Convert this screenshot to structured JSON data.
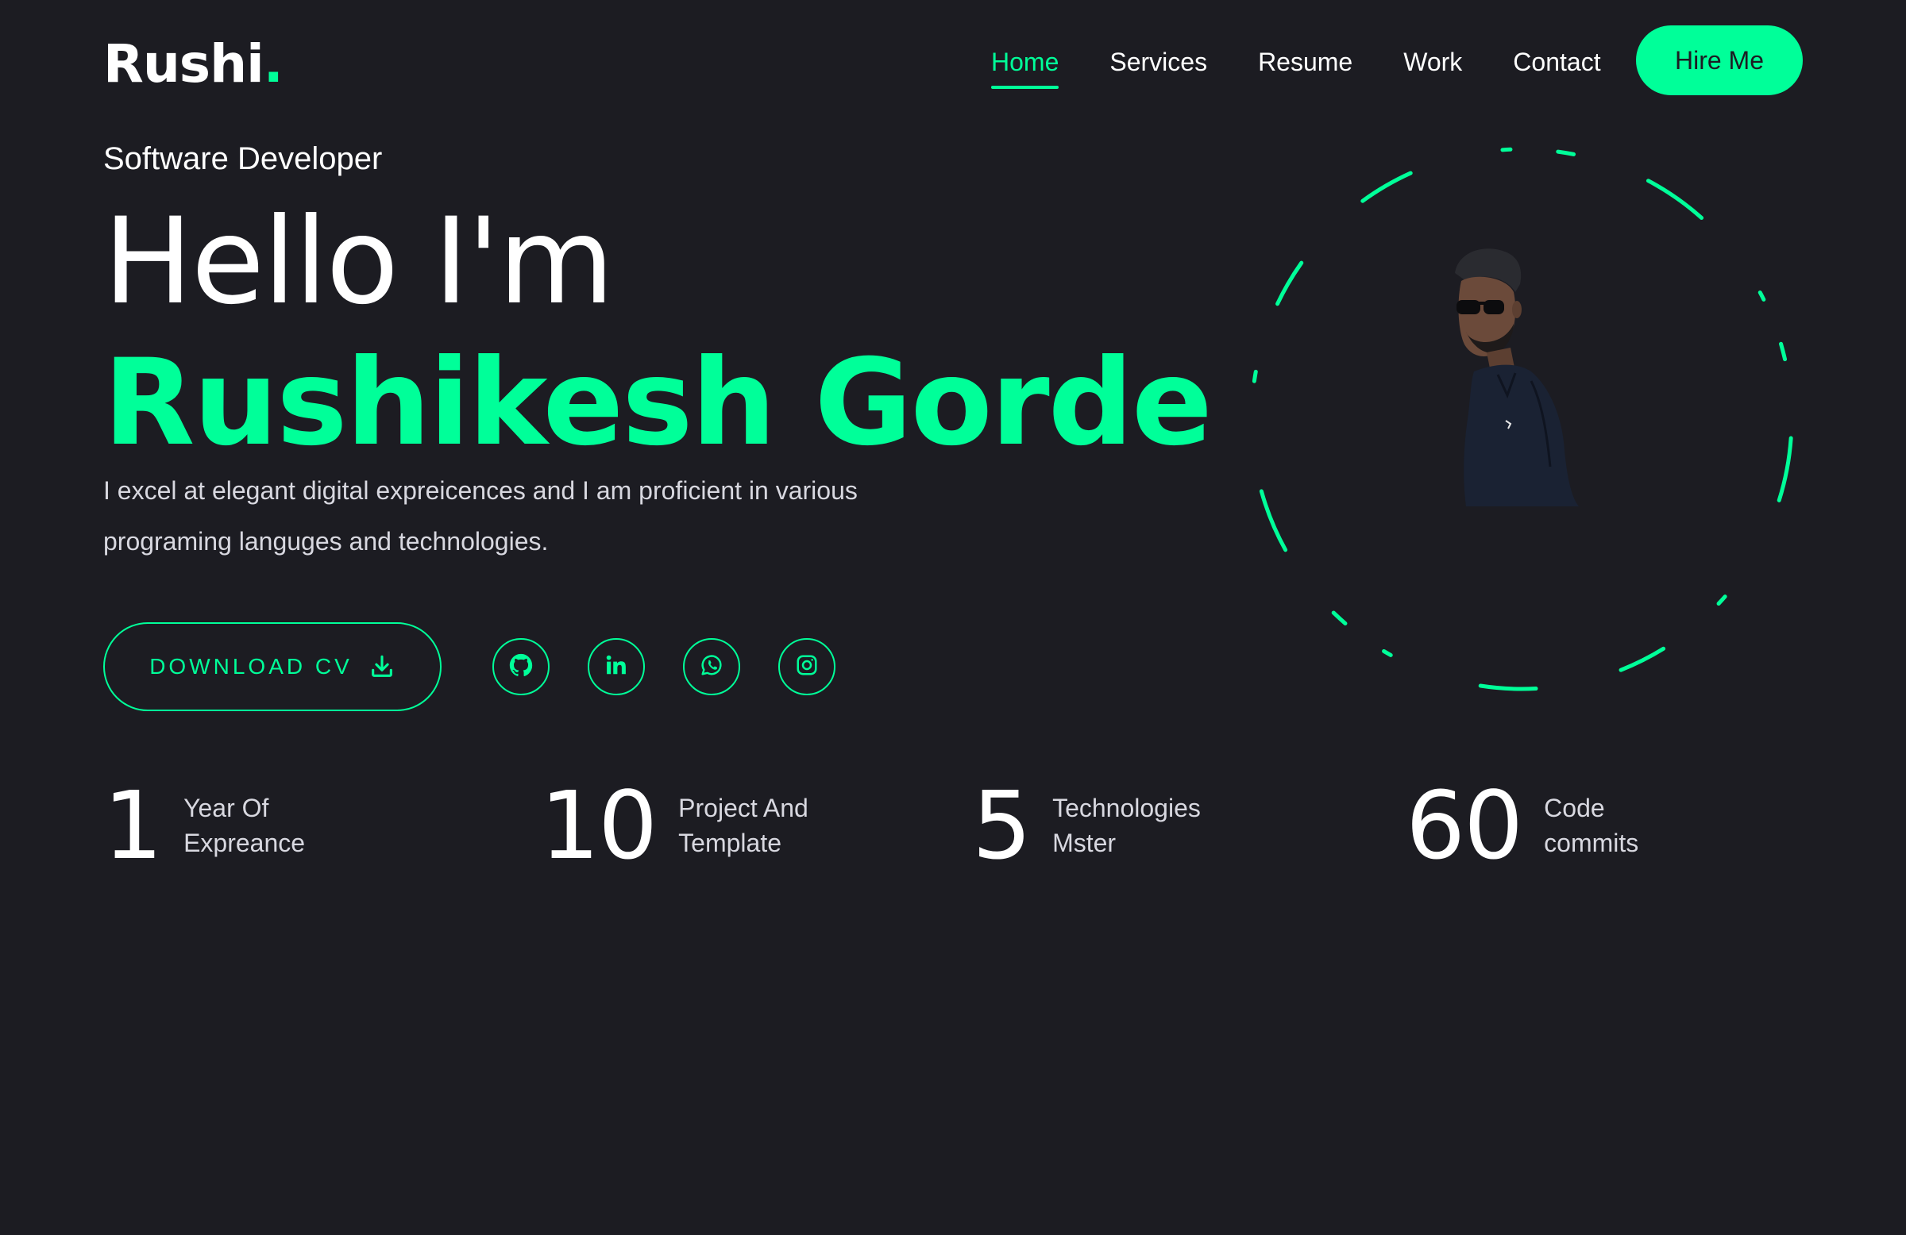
{
  "brand": {
    "name": "Rushi",
    "dot": "."
  },
  "nav": {
    "items": [
      {
        "label": "Home",
        "active": true
      },
      {
        "label": "Services",
        "active": false
      },
      {
        "label": "Resume",
        "active": false
      },
      {
        "label": "Work",
        "active": false
      },
      {
        "label": "Contact",
        "active": false
      }
    ],
    "hire_label": "Hire Me"
  },
  "hero": {
    "role": "Software Developer",
    "greeting": "Hello I'm",
    "name": "Rushikesh Gorde",
    "description_line1": "I excel at elegant digital expreicences and I am proficient in various",
    "description_line2": "programing languges and technologies.",
    "download_label": "DOWNLOAD CV"
  },
  "socials": [
    {
      "icon": "github-icon"
    },
    {
      "icon": "linkedin-icon"
    },
    {
      "icon": "whatsapp-icon"
    },
    {
      "icon": "instagram-icon"
    }
  ],
  "stats": [
    {
      "value": "1",
      "label_line1": "Year Of",
      "label_line2": "Expreance"
    },
    {
      "value": "10",
      "label_line1": "Project And",
      "label_line2": "Template"
    },
    {
      "value": "5",
      "label_line1": "Technologies",
      "label_line2": "Mster"
    },
    {
      "value": "60",
      "label_line1": "Code",
      "label_line2": "commits"
    }
  ],
  "colors": {
    "background": "#1c1c22",
    "accent": "#00ff99",
    "text": "#ffffff",
    "muted_text": "#d8d8e0"
  }
}
